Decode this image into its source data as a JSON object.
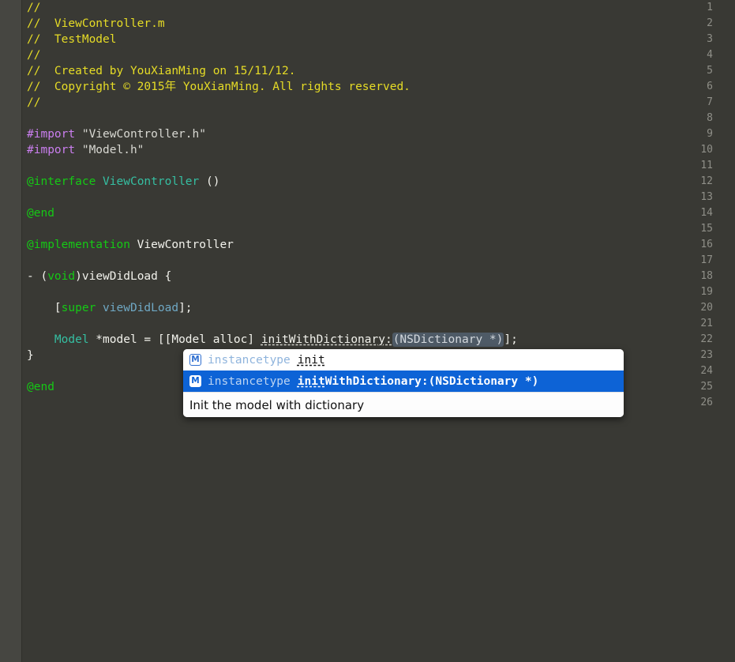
{
  "editor": {
    "filename": "ViewController.m",
    "background_color": "#393934",
    "gutter_color": "#464641",
    "line_numbers": [
      "1",
      "2",
      "3",
      "4",
      "5",
      "6",
      "7",
      "8",
      "9",
      "10",
      "11",
      "12",
      "13",
      "14",
      "15",
      "16",
      "17",
      "18",
      "19",
      "20",
      "21",
      "22",
      "23",
      "24",
      "25",
      "26"
    ],
    "colors": {
      "comment": "#e6dc26",
      "preprocessor": "#cb7ff0",
      "string": "#d8d8d2",
      "keyword": "#15c915",
      "class_name": "#35bfa2",
      "plain_text": "#f2f2ec",
      "method_call": "#6fa8c4",
      "placeholder_background": "#4e5a66",
      "selection_blue": "#0d63d6"
    },
    "lines": [
      {
        "n": "1",
        "segments": [
          {
            "t": "comment",
            "s": "//"
          }
        ]
      },
      {
        "n": "2",
        "segments": [
          {
            "t": "comment",
            "s": "//  ViewController.m"
          }
        ]
      },
      {
        "n": "3",
        "segments": [
          {
            "t": "comment",
            "s": "//  TestModel"
          }
        ]
      },
      {
        "n": "4",
        "segments": [
          {
            "t": "comment",
            "s": "//"
          }
        ]
      },
      {
        "n": "5",
        "segments": [
          {
            "t": "comment",
            "s": "//  Created by YouXianMing on 15/11/12."
          }
        ]
      },
      {
        "n": "6",
        "segments": [
          {
            "t": "comment",
            "s": "//  Copyright © 2015年 YouXianMing. All rights reserved."
          }
        ]
      },
      {
        "n": "7",
        "segments": [
          {
            "t": "comment",
            "s": "//"
          }
        ]
      },
      {
        "n": "8",
        "segments": []
      },
      {
        "n": "9",
        "segments": [
          {
            "t": "pre",
            "s": "#import"
          },
          {
            "t": "plain",
            "s": " "
          },
          {
            "t": "string",
            "s": "\"ViewController.h\""
          }
        ]
      },
      {
        "n": "10",
        "segments": [
          {
            "t": "pre",
            "s": "#import"
          },
          {
            "t": "plain",
            "s": " "
          },
          {
            "t": "string",
            "s": "\"Model.h\""
          }
        ]
      },
      {
        "n": "11",
        "segments": []
      },
      {
        "n": "12",
        "segments": [
          {
            "t": "keyword",
            "s": "@interface"
          },
          {
            "t": "plain",
            "s": " "
          },
          {
            "t": "class",
            "s": "ViewController"
          },
          {
            "t": "plain",
            "s": " ()"
          }
        ]
      },
      {
        "n": "13",
        "segments": []
      },
      {
        "n": "14",
        "segments": [
          {
            "t": "keyword",
            "s": "@end"
          }
        ]
      },
      {
        "n": "15",
        "segments": []
      },
      {
        "n": "16",
        "segments": [
          {
            "t": "keyword",
            "s": "@implementation"
          },
          {
            "t": "plain",
            "s": " ViewController"
          }
        ]
      },
      {
        "n": "17",
        "segments": []
      },
      {
        "n": "18",
        "segments": [
          {
            "t": "plain",
            "s": "- ("
          },
          {
            "t": "keyword",
            "s": "void"
          },
          {
            "t": "plain",
            "s": ")viewDidLoad {"
          }
        ]
      },
      {
        "n": "19",
        "segments": []
      },
      {
        "n": "20",
        "segments": [
          {
            "t": "plain",
            "s": "    ["
          },
          {
            "t": "keyword",
            "s": "super"
          },
          {
            "t": "plain",
            "s": " "
          },
          {
            "t": "method",
            "s": "viewDidLoad"
          },
          {
            "t": "plain",
            "s": "];"
          }
        ]
      },
      {
        "n": "21",
        "segments": []
      },
      {
        "n": "22",
        "segments": [
          {
            "t": "plain",
            "s": "    "
          },
          {
            "t": "class",
            "s": "Model"
          },
          {
            "t": "plain",
            "s": " *model = [[Model alloc] "
          },
          {
            "t": "underline",
            "s": "initWithDictionary:"
          },
          {
            "t": "argplaceholder",
            "s": "(NSDictionary *)"
          },
          {
            "t": "plain",
            "s": "];"
          }
        ]
      },
      {
        "n": "23",
        "segments": [
          {
            "t": "plain",
            "s": "}"
          }
        ]
      },
      {
        "n": "24",
        "segments": []
      },
      {
        "n": "25",
        "segments": [
          {
            "t": "keyword",
            "s": "@end"
          }
        ]
      },
      {
        "n": "26",
        "segments": []
      }
    ]
  },
  "autocomplete": {
    "rows": [
      {
        "badge": "M",
        "badge_icon_name": "method-badge-icon",
        "return_type": "instancetype",
        "match_prefix": "init",
        "name_rest": "",
        "selected": false
      },
      {
        "badge": "M",
        "badge_icon_name": "method-badge-icon",
        "return_type": "instancetype",
        "match_prefix": "init",
        "name_rest": "WithDictionary:(NSDictionary *)",
        "selected": true
      }
    ],
    "description": "Init the model with dictionary"
  }
}
